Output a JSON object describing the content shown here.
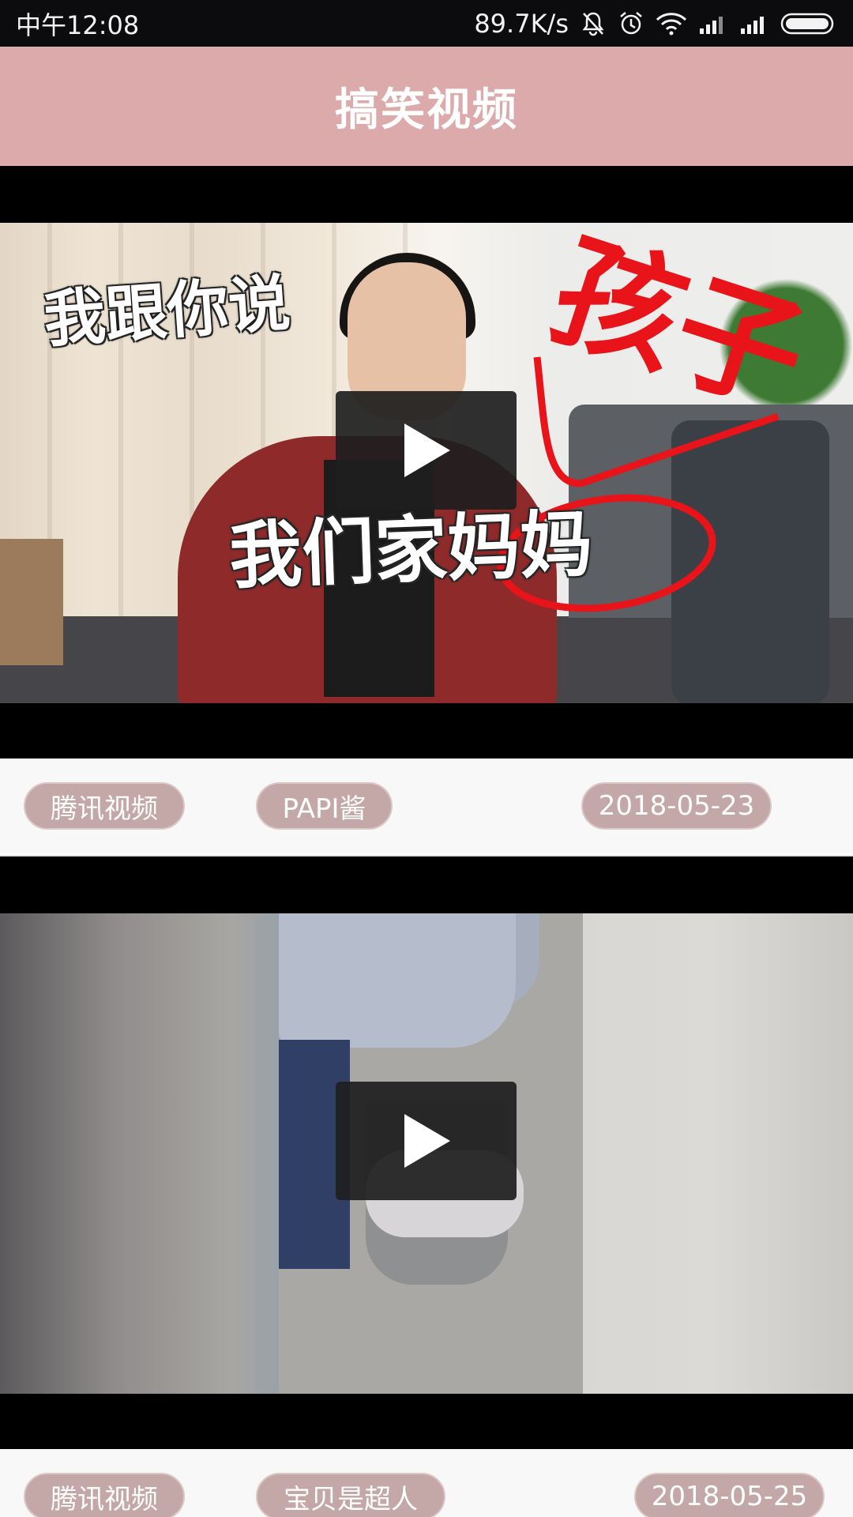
{
  "status_bar": {
    "time": "中午12:08",
    "network_speed": "89.7K/s",
    "icons": [
      "bell-off-icon",
      "alarm-icon",
      "wifi-icon",
      "signal-icon",
      "signal-icon",
      "battery-icon"
    ]
  },
  "app_bar": {
    "title": "搞笑视频"
  },
  "videos": [
    {
      "overlay_top": "我跟你说",
      "overlay_bottom": "我们家妈妈",
      "scribble": "孩子",
      "source": "腾讯视频",
      "author": "PAPI酱",
      "date": "2018-05-23"
    },
    {
      "source": "腾讯视频",
      "author": "宝贝是超人",
      "date": "2018-05-25"
    }
  ],
  "colors": {
    "app_bar": "#dcaaaa",
    "chip": "#c4a8a8",
    "status_bar": "#0c0c0e"
  }
}
